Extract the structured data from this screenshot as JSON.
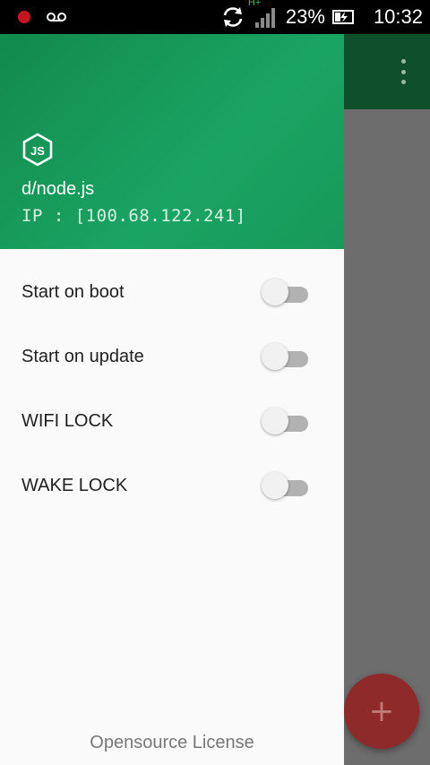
{
  "status_bar": {
    "battery_percent": "23%",
    "time": "10:32",
    "network_type": "H+",
    "icons": [
      "record-dot-icon",
      "voicemail-icon",
      "sync-icon",
      "signal-icon",
      "battery-charging-icon"
    ]
  },
  "drawer": {
    "header": {
      "logo": "nodejs-icon",
      "title": "d/node.js",
      "ip": "IP : [100.68.122.241]"
    },
    "settings": [
      {
        "label": "Start on boot",
        "enabled": false
      },
      {
        "label": "Start on update",
        "enabled": false
      },
      {
        "label": "WIFI LOCK",
        "enabled": false
      },
      {
        "label": "WAKE LOCK",
        "enabled": false
      }
    ],
    "footer_link": "Opensource License"
  },
  "app": {
    "overflow_icon": "more-vert-icon",
    "fab_icon": "add-icon",
    "fab_symbol": "+"
  },
  "colors": {
    "header_green": "#1aa463",
    "toolbar_dark_green": "#0f4f2c",
    "fab_red": "#8e2a2a",
    "status_red": "#c4161c"
  }
}
